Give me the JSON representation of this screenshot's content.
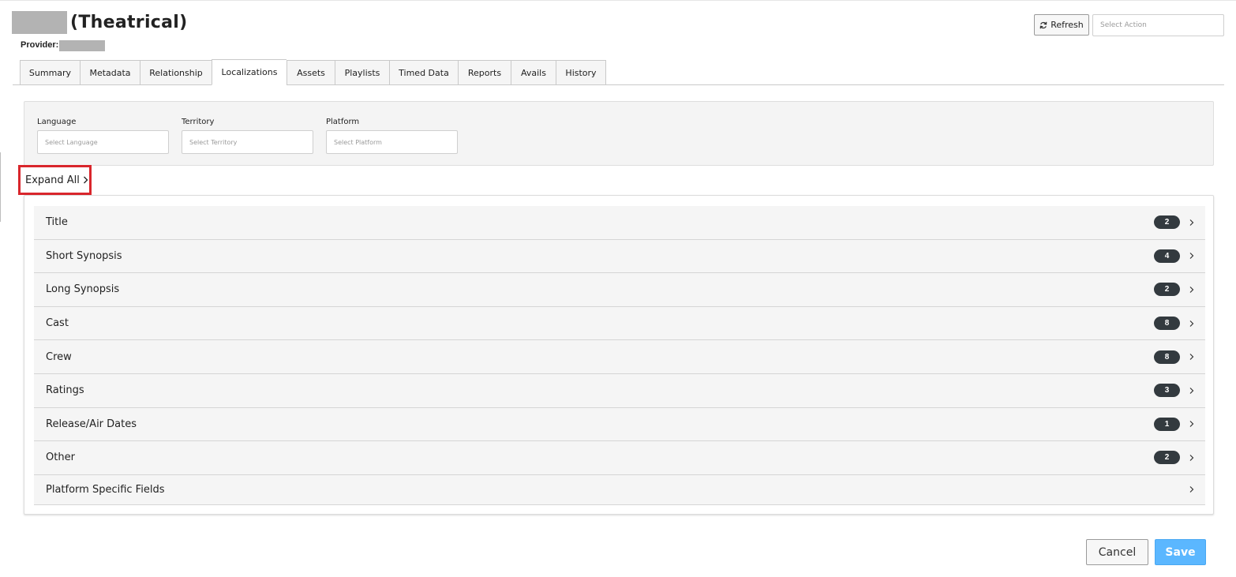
{
  "header": {
    "title_suffix": "(Theatrical)",
    "provider_label": "Provider:",
    "refresh_label": "Refresh",
    "refresh_icon": "refresh-icon",
    "action_placeholder": "Select Action"
  },
  "tabs": [
    {
      "label": "Summary",
      "active": false
    },
    {
      "label": "Metadata",
      "active": false
    },
    {
      "label": "Relationship",
      "active": false
    },
    {
      "label": "Localizations",
      "active": true
    },
    {
      "label": "Assets",
      "active": false
    },
    {
      "label": "Playlists",
      "active": false
    },
    {
      "label": "Timed Data",
      "active": false
    },
    {
      "label": "Reports",
      "active": false
    },
    {
      "label": "Avails",
      "active": false
    },
    {
      "label": "History",
      "active": false
    }
  ],
  "filters": {
    "language": {
      "label": "Language",
      "placeholder": "Select Language"
    },
    "territory": {
      "label": "Territory",
      "placeholder": "Select Territory"
    },
    "platform": {
      "label": "Platform",
      "placeholder": "Select Platform"
    }
  },
  "expand_all": {
    "label": "Expand All",
    "icon": "chevron-right-icon"
  },
  "sections": [
    {
      "label": "Title",
      "count": "2"
    },
    {
      "label": "Short Synopsis",
      "count": "4"
    },
    {
      "label": "Long Synopsis",
      "count": "2"
    },
    {
      "label": "Cast",
      "count": "8"
    },
    {
      "label": "Crew",
      "count": "8"
    },
    {
      "label": "Ratings",
      "count": "3"
    },
    {
      "label": "Release/Air Dates",
      "count": "1"
    },
    {
      "label": "Other",
      "count": "2"
    },
    {
      "label": "Platform Specific Fields",
      "count": ""
    }
  ],
  "footer": {
    "cancel_label": "Cancel",
    "save_label": "Save"
  },
  "colors": {
    "highlight_border": "#d9262c",
    "save_button": "#5bb7ff",
    "badge": "#333a3f"
  }
}
